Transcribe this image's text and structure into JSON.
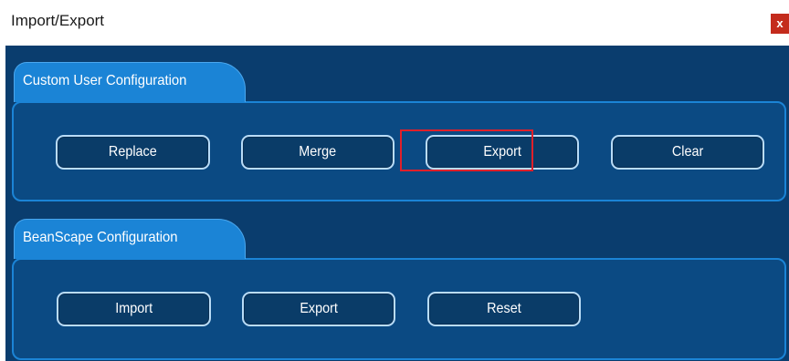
{
  "window": {
    "title": "Import/Export",
    "close_label": "x"
  },
  "colors": {
    "body_background": "#0a3d6e",
    "panel_background": "#0b4a83",
    "tab_background": "#1b84d6",
    "button_background": "#0a3c68",
    "button_border": "#b9dcf7",
    "highlight": "#e0202a",
    "close_button": "#c42b1c"
  },
  "custom_user_configuration": {
    "tab_label": "Custom User Configuration",
    "buttons": [
      {
        "label": "Replace"
      },
      {
        "label": "Merge"
      },
      {
        "label": "Export"
      },
      {
        "label": "Clear"
      }
    ]
  },
  "beanscape_configuration": {
    "tab_label": "BeanScape Configuration",
    "buttons": [
      {
        "label": "Import"
      },
      {
        "label": "Export"
      },
      {
        "label": "Reset"
      }
    ]
  }
}
